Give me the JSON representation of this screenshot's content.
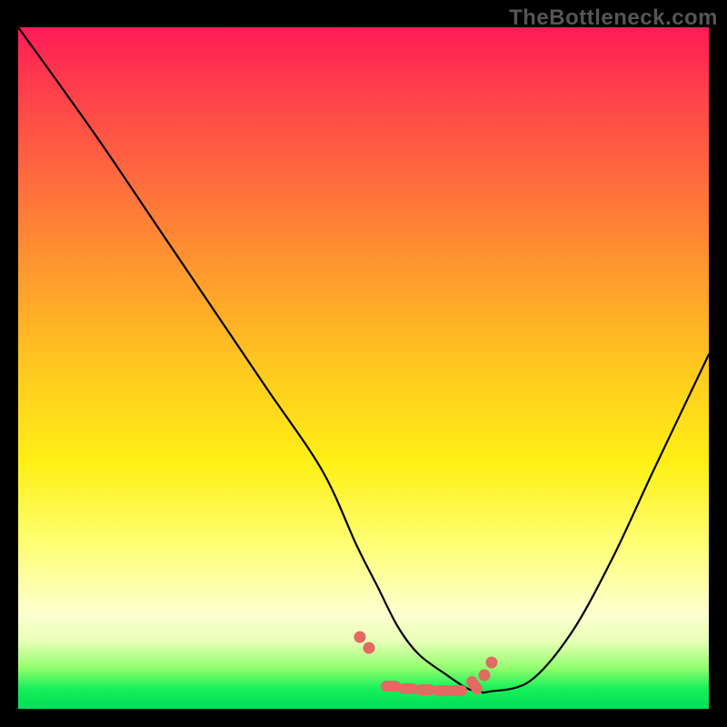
{
  "watermark": "TheBottleneck.com",
  "chart_data": {
    "type": "line",
    "title": "",
    "xlabel": "",
    "ylabel": "",
    "xlim": [
      0,
      100
    ],
    "ylim": [
      0,
      100
    ],
    "note": "Axes unlabeled; V-shaped bottleneck curve. x is normalized position along horizontal axis, y is normalized height (100=top, 0=bottom). Values read from pixel positions.",
    "series": [
      {
        "name": "bottleneck-curve",
        "x": [
          0,
          5,
          12,
          20,
          28,
          36,
          44,
          49,
          52,
          55,
          58,
          62,
          65,
          67,
          68,
          74,
          80,
          86,
          92,
          100
        ],
        "y": [
          100,
          93,
          83,
          71,
          59,
          47,
          35,
          24,
          18,
          12,
          8,
          5,
          3,
          2.5,
          2.5,
          4,
          11,
          22,
          35,
          52
        ]
      }
    ],
    "annotations_beads": {
      "description": "Short salmon-colored bead/pill markers along the bottom of the valley",
      "points_xy": [
        [
          49.5,
          10.5
        ],
        [
          50.8,
          9.0
        ],
        [
          54.0,
          3.3
        ],
        [
          56.5,
          3.0
        ],
        [
          59.0,
          2.8
        ],
        [
          61.5,
          2.7
        ],
        [
          63.5,
          2.7
        ],
        [
          66.0,
          3.5
        ],
        [
          67.5,
          5.0
        ],
        [
          68.5,
          6.8
        ]
      ]
    },
    "gradient_colors": {
      "top": "#ff1a57",
      "mid_upper": "#ff9a2e",
      "mid": "#fff016",
      "mid_lower": "#fdffd0",
      "bottom": "#00df57"
    }
  }
}
